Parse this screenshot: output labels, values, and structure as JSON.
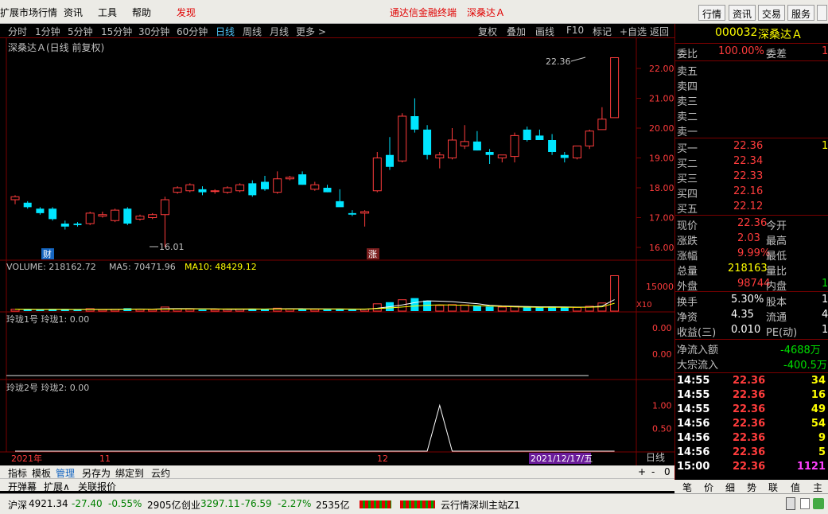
{
  "menu": {
    "left_title": "扩展市场行情",
    "items": [
      "资讯",
      "工具",
      "帮助"
    ],
    "discover": "发现",
    "center": "通达信金融终端",
    "center_stock": "深桑达Ａ",
    "buttons": [
      "行情",
      "资讯",
      "交易",
      "服务"
    ]
  },
  "toolbar": {
    "periods": [
      "分时",
      "1分钟",
      "5分钟",
      "15分钟",
      "30分钟",
      "60分钟",
      "日线",
      "周线",
      "月线",
      "更多 >"
    ],
    "actions": [
      "复权",
      "叠加",
      "画线",
      "F10",
      "标记",
      "+自选",
      "返回"
    ]
  },
  "chart_header": {
    "title": "深桑达Ａ(日线 前复权)"
  },
  "volume_header": {
    "label": "VOLUME: 218162.72",
    "ma5": "MA5: 70471.96",
    "ma10": "MA10: 48429.12"
  },
  "ind1_header": {
    "label": "玲珑1号  玲珑1: 0.00"
  },
  "ind2_header": {
    "label": "玲珑2号  玲珑2: 0.00"
  },
  "price_axis": [
    "22.00",
    "21.00",
    "20.00",
    "19.00",
    "18.00",
    "17.00",
    "16.00"
  ],
  "vol_axis": {
    "value": "15000",
    "unit": "X10"
  },
  "ind1_axis": [
    "0.00",
    "0.00"
  ],
  "ind2_axis": [
    "1.00",
    "0.50"
  ],
  "annotations": {
    "high": "22.36",
    "low": "16.01",
    "cai": "财",
    "zhang": "涨"
  },
  "x_labels": {
    "year": "2021年",
    "m11": "11",
    "m12": "12",
    "date": "2021/12/17/五"
  },
  "period_label": "日线",
  "zoom": {
    "plus": "+",
    "minus": "-",
    "zero": "0"
  },
  "chart_data": {
    "type": "candlestick",
    "ohlc": [
      [
        17.6,
        17.75,
        17.45,
        17.7
      ],
      [
        17.5,
        17.55,
        17.3,
        17.35
      ],
      [
        17.3,
        17.35,
        17.1,
        17.15
      ],
      [
        17.3,
        17.35,
        16.9,
        16.95
      ],
      [
        16.8,
        16.9,
        16.6,
        16.7
      ],
      [
        16.8,
        16.85,
        16.7,
        16.75
      ],
      [
        16.8,
        17.2,
        16.75,
        17.15
      ],
      [
        17.05,
        17.2,
        17.0,
        17.1
      ],
      [
        16.9,
        17.3,
        16.85,
        17.25
      ],
      [
        17.3,
        17.35,
        16.75,
        16.8
      ],
      [
        16.95,
        17.1,
        16.9,
        17.05
      ],
      [
        17.0,
        17.15,
        16.95,
        17.1
      ],
      [
        17.1,
        17.7,
        16.01,
        17.6
      ],
      [
        17.85,
        18.05,
        17.8,
        18.0
      ],
      [
        17.9,
        18.15,
        17.85,
        18.1
      ],
      [
        17.95,
        18.05,
        17.75,
        17.85
      ],
      [
        17.9,
        17.95,
        17.8,
        17.9
      ],
      [
        17.85,
        18.05,
        17.8,
        18.0
      ],
      [
        17.9,
        18.15,
        17.85,
        18.1
      ],
      [
        18.15,
        18.25,
        17.7,
        17.75
      ],
      [
        18.2,
        18.4,
        17.9,
        17.95
      ],
      [
        17.85,
        18.55,
        17.8,
        18.3
      ],
      [
        18.3,
        18.4,
        18.25,
        18.35
      ],
      [
        18.45,
        18.55,
        18.1,
        18.1
      ],
      [
        17.95,
        18.2,
        17.9,
        18.1
      ],
      [
        18.0,
        18.1,
        17.85,
        17.85
      ],
      [
        17.55,
        17.95,
        17.4,
        17.35
      ],
      [
        17.15,
        17.25,
        17.05,
        17.1
      ],
      [
        17.15,
        17.25,
        16.7,
        17.2
      ],
      [
        17.9,
        19.2,
        17.85,
        19.0
      ],
      [
        19.1,
        19.7,
        18.6,
        18.7
      ],
      [
        18.9,
        20.5,
        18.85,
        20.4
      ],
      [
        20.4,
        21.0,
        19.85,
        19.95
      ],
      [
        19.95,
        20.1,
        18.95,
        19.1
      ],
      [
        19.0,
        19.2,
        18.65,
        19.1
      ],
      [
        19.0,
        20.0,
        18.95,
        19.6
      ],
      [
        19.4,
        20.1,
        19.3,
        19.55
      ],
      [
        19.55,
        19.9,
        19.25,
        19.25
      ],
      [
        19.2,
        19.3,
        18.8,
        19.1
      ],
      [
        19.0,
        19.1,
        18.85,
        19.1
      ],
      [
        19.05,
        19.85,
        18.85,
        19.75
      ],
      [
        19.95,
        20.05,
        19.55,
        19.6
      ],
      [
        19.75,
        19.95,
        19.6,
        19.6
      ],
      [
        19.6,
        19.8,
        19.1,
        19.2
      ],
      [
        19.1,
        19.2,
        18.85,
        19.0
      ],
      [
        19.0,
        19.4,
        18.95,
        19.4
      ],
      [
        19.4,
        19.95,
        19.3,
        19.9
      ],
      [
        19.95,
        20.7,
        19.95,
        20.3
      ],
      [
        20.35,
        22.36,
        20.35,
        22.36
      ]
    ],
    "volume": [
      1200,
      1100,
      900,
      1300,
      1000,
      800,
      1500,
      900,
      1200,
      1800,
      1100,
      1000,
      2500,
      1400,
      1200,
      900,
      1000,
      1100,
      1200,
      1500,
      1400,
      1800,
      1300,
      1200,
      1100,
      1000,
      1400,
      900,
      1200,
      4500,
      5500,
      7000,
      8000,
      6500,
      3500,
      4000,
      3800,
      3200,
      2800,
      2500,
      3000,
      2600,
      2400,
      2800,
      2200,
      2300,
      3000,
      5000,
      21816
    ],
    "ma5": [
      1200,
      1150,
      1070,
      1120,
      1100,
      1020,
      1100,
      1100,
      1140,
      1240,
      1300,
      1200,
      1500,
      1520,
      1520,
      1400,
      1400,
      1120,
      1080,
      1140,
      1240,
      1400,
      1440,
      1440,
      1400,
      1320,
      1260,
      1180,
      1120,
      1800,
      2700,
      3800,
      5240,
      6300,
      6100,
      5800,
      5160,
      4600,
      3560,
      3160,
      2960,
      2820,
      2660,
      2660,
      2560,
      2460,
      2540,
      3060,
      7063
    ],
    "ma10": [
      1200,
      1150,
      1070,
      1120,
      1100,
      1050,
      1080,
      1060,
      1070,
      1140,
      1160,
      1150,
      1200,
      1280,
      1340,
      1350,
      1310,
      1320,
      1370,
      1360,
      1310,
      1320,
      1310,
      1310,
      1300,
      1300,
      1330,
      1280,
      1260,
      1560,
      1980,
      2500,
      3120,
      3630,
      3860,
      3740,
      3600,
      3310,
      3140,
      2890,
      2580,
      2450,
      2320,
      2300,
      2300,
      2300,
      2390,
      2660,
      4842
    ],
    "ind2": [
      0,
      0,
      0,
      0,
      0,
      0,
      0,
      0,
      0,
      0,
      0,
      0,
      0,
      0,
      0,
      0,
      0,
      0,
      0,
      0,
      0,
      0,
      0,
      0,
      0,
      0,
      0,
      0,
      0,
      0,
      0,
      0,
      0,
      0,
      1,
      0,
      0,
      0,
      0,
      0,
      0,
      0,
      0,
      0,
      0,
      0,
      0,
      0,
      0
    ]
  },
  "stock": {
    "code": "000032",
    "name": "深桑达Ａ"
  },
  "quote": {
    "weibi_label": "委比",
    "weibi": "100.00%",
    "weicha_label": "委差",
    "weicha": "1",
    "sells": [
      {
        "label": "卖五"
      },
      {
        "label": "卖四"
      },
      {
        "label": "卖三"
      },
      {
        "label": "卖二"
      },
      {
        "label": "卖一"
      }
    ],
    "buys": [
      {
        "label": "买一",
        "price": "22.36",
        "vol": "1"
      },
      {
        "label": "买二",
        "price": "22.34",
        "vol": ""
      },
      {
        "label": "买三",
        "price": "22.33",
        "vol": ""
      },
      {
        "label": "买四",
        "price": "22.16",
        "vol": ""
      },
      {
        "label": "买五",
        "price": "22.12",
        "vol": ""
      }
    ],
    "rows": [
      {
        "l1": "现价",
        "v1": "22.36",
        "c1": "red",
        "l2": "今开"
      },
      {
        "l1": "涨跌",
        "v1": "2.03",
        "c1": "red",
        "l2": "最高"
      },
      {
        "l1": "涨幅",
        "v1": "9.99%",
        "c1": "red",
        "l2": "最低"
      },
      {
        "l1": "总量",
        "v1": "218163",
        "c1": "yel",
        "l2": "量比"
      },
      {
        "l1": "外盘",
        "v1": "98744",
        "c1": "red",
        "l2": "内盘",
        "v2": "1"
      }
    ],
    "rows2": [
      {
        "l1": "换手",
        "v1": "5.30%",
        "c1": "lbl",
        "l2": "股本",
        "v2": "1"
      },
      {
        "l1": "净资",
        "v1": "4.35",
        "c1": "lbl",
        "l2": "流通",
        "v2": "4"
      },
      {
        "l1": "收益(三)",
        "v1": "0.010",
        "c1": "lbl",
        "l2": "PE(动)",
        "v2": "1"
      }
    ],
    "netflow_label": "净流入额",
    "netflow": "-4688万",
    "block_label": "大宗流入",
    "block": "-400.5万"
  },
  "ticks": [
    {
      "t": "14:55",
      "p": "22.36",
      "v": "34",
      "c": "yel"
    },
    {
      "t": "14:55",
      "p": "22.36",
      "v": "16",
      "c": "yel"
    },
    {
      "t": "14:55",
      "p": "22.36",
      "v": "49",
      "c": "yel"
    },
    {
      "t": "14:56",
      "p": "22.36",
      "v": "54",
      "c": "yel"
    },
    {
      "t": "14:56",
      "p": "22.36",
      "v": "9",
      "c": "yel"
    },
    {
      "t": "14:56",
      "p": "22.36",
      "v": "5",
      "c": "yel"
    },
    {
      "t": "15:00",
      "p": "22.36",
      "v": "1121",
      "c": "mag"
    }
  ],
  "bottom": {
    "row1": [
      "指标",
      "模板",
      "管理",
      "另存为",
      "绑定到",
      "云约"
    ],
    "row2": [
      "开弹幕",
      "扩展∧",
      "关联报价"
    ],
    "rtabs": [
      "笔",
      "价",
      "细",
      "势",
      "联",
      "值",
      "主"
    ]
  },
  "status": {
    "sh_label": "沪深",
    "sh_val": "4921.34",
    "sh_chg": "-27.40",
    "sh_pct": "-0.55%",
    "sh_amt": "2905亿",
    "cy_label": "创业",
    "cy_val": "3297.11",
    "cy_chg": "-76.59",
    "cy_pct": "-2.27%",
    "cy_amt": "2535亿",
    "server": "云行情深圳主站Z1"
  }
}
